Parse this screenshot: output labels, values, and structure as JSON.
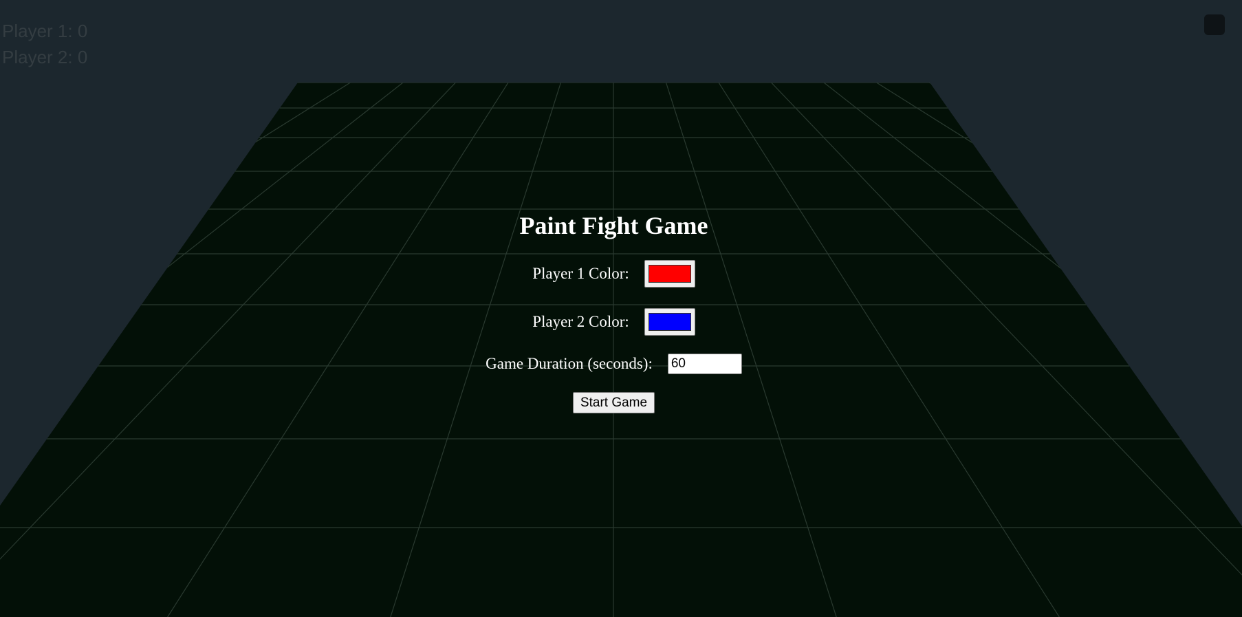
{
  "scoreboard": {
    "player1": "Player 1: 0",
    "player2": "Player 2: 0"
  },
  "menu": {
    "title": "Paint Fight Game",
    "player1_color_label": "Player 1 Color:",
    "player1_color": "#ff0000",
    "player2_color_label": "Player 2 Color:",
    "player2_color": "#0000ff",
    "duration_label": "Game Duration (seconds):",
    "duration_value": "60",
    "start_label": "Start Game"
  },
  "colors": {
    "background": "#1c272e",
    "floor": "#031007",
    "grid_line": "#2a3a30"
  }
}
